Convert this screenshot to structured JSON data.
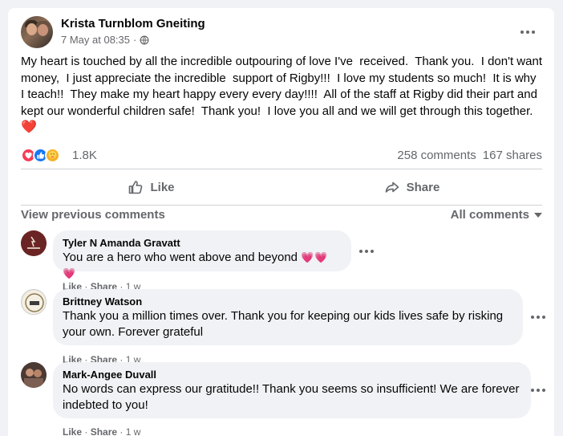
{
  "post": {
    "author": "Krista Turnblom Gneiting",
    "timestamp": "7 May at 08:35",
    "separator": "·",
    "privacy_icon": "globe-icon",
    "text": "My heart is touched by all the incredible outpouring of love I've  received.  Thank you.  I don't want money,  I just appreciate the incredible  support of Rigby!!!  I love my students so much!  It is why I teach!!  They make my heart happy every every day!!!!  All of the staff at Rigby did their part and kept our wonderful children safe!  Thank you!  I love you all and we will get through this together.",
    "text_emoji": "❤️"
  },
  "stats": {
    "reaction_icons": [
      "love-icon",
      "like-icon",
      "care-icon"
    ],
    "reaction_count": "1.8K",
    "comments": "258 comments",
    "shares": "167 shares"
  },
  "actions": {
    "like_label": "Like",
    "share_label": "Share"
  },
  "comments_bar": {
    "view_previous": "View previous comments",
    "filter": "All comments"
  },
  "comments": [
    {
      "name": "Tyler N Amanda Gravatt",
      "text": "You are a hero who went above and beyond",
      "emoji": "💗💗💗",
      "like": "Like",
      "share": "Share",
      "time": "1 w"
    },
    {
      "name": "Brittney Watson",
      "text": "Thank you a million times over. Thank you for keeping our kids lives safe by risking your own. Forever grateful",
      "like": "Like",
      "share": "Share",
      "time": "1 w"
    },
    {
      "name": "Mark-Angee Duvall",
      "text": "No words can express our gratitude!! Thank you seems so insufficient! We are forever indebted to you!",
      "like": "Like",
      "share": "Share",
      "time": "1 w"
    }
  ],
  "colors": {
    "love": "#f33e58",
    "like": "#1877f2",
    "care": "#f7b125",
    "secondary_text": "#65676b",
    "bubble": "#f0f2f5"
  }
}
